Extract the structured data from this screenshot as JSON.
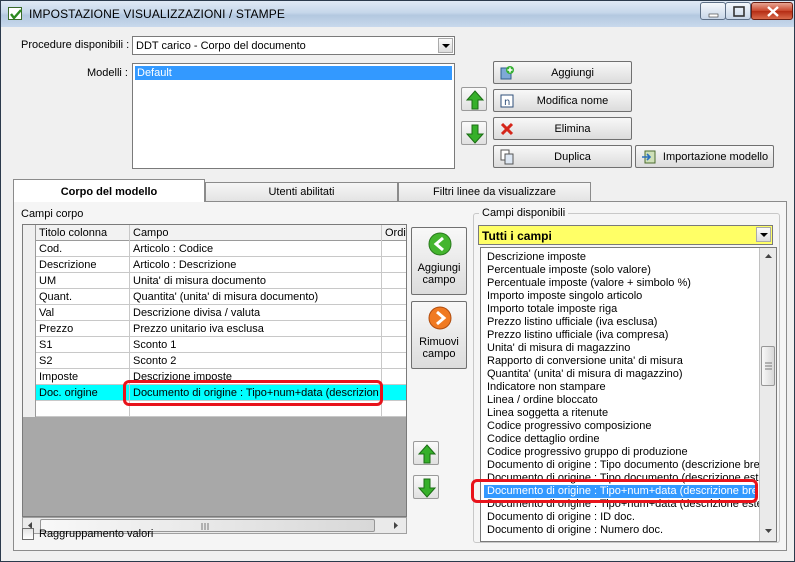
{
  "window": {
    "title": "IMPOSTAZIONE VISUALIZZAZIONI / STAMPE"
  },
  "procedure": {
    "label": "Procedure disponibili :",
    "selected": "DDT carico - Corpo del documento"
  },
  "modelli": {
    "label": "Modelli :",
    "items": [
      "Default"
    ]
  },
  "buttons": {
    "aggiungi": "Aggiungi",
    "modifica_nome": "Modifica nome",
    "elimina": "Elimina",
    "duplica": "Duplica",
    "importazione_modello": "Importazione modello",
    "aggiungi_campo_line1": "Aggiungi",
    "aggiungi_campo_line2": "campo",
    "rimuovi_campo_line1": "Rimuovi",
    "rimuovi_campo_line2": "campo"
  },
  "tabs": [
    {
      "label": "Corpo del modello",
      "active": true
    },
    {
      "label": "Utenti abilitati",
      "active": false
    },
    {
      "label": "Filtri linee da visualizzare",
      "active": false
    }
  ],
  "campi_corpo": {
    "group_label": "Campi corpo",
    "columns": [
      "Titolo colonna",
      "Campo",
      "Ordi"
    ],
    "rows": [
      {
        "titolo": "Cod.",
        "campo": "Articolo : Codice"
      },
      {
        "titolo": "Descrizione",
        "campo": "Articolo : Descrizione"
      },
      {
        "titolo": "UM",
        "campo": "Unita' di misura documento"
      },
      {
        "titolo": "Quant.",
        "campo": "Quantita' (unita' di misura documento)"
      },
      {
        "titolo": "Val",
        "campo": "Descrizione divisa / valuta"
      },
      {
        "titolo": "Prezzo",
        "campo": "Prezzo unitario iva esclusa"
      },
      {
        "titolo": "S1",
        "campo": "Sconto 1"
      },
      {
        "titolo": "S2",
        "campo": "Sconto 2"
      },
      {
        "titolo": "Imposte",
        "campo": "Descrizione imposte"
      },
      {
        "titolo": "Doc. origine",
        "campo": "Documento di origine : Tipo+num+data (descrizion..."
      }
    ],
    "selected_row": 9
  },
  "raggruppamento": {
    "label": "Raggruppamento valori",
    "checked": false
  },
  "campi_disponibili": {
    "group_label": "Campi disponibili",
    "filter_selected": "Tutti i campi",
    "filter_color": "#ffff66",
    "items": [
      "Descrizione imposte",
      "Percentuale imposte (solo valore)",
      "Percentuale imposte (valore + simbolo %)",
      "Importo imposte singolo articolo",
      "Importo totale imposte riga",
      "Prezzo listino ufficiale (iva esclusa)",
      "Prezzo listino ufficiale (iva compresa)",
      "Unita' di misura di magazzino",
      "Rapporto di conversione unita' di misura",
      "Quantita' (unita' di misura di magazzino)",
      "Indicatore non stampare",
      "Linea / ordine bloccato",
      "Linea soggetta a ritenute",
      "Codice progressivo composizione",
      "Codice dettaglio ordine",
      "Codice progressivo gruppo di produzione",
      "Documento di origine : Tipo documento (descrizione breve)",
      "Documento di origine : Tipo documento (descrizione estesa)",
      "Documento di origine : Tipo+num+data (descrizione breve)",
      "Documento di origine : Tipo+num+data (descrizione estesa)",
      "Documento di origine : ID doc.",
      "Documento di origine : Numero doc."
    ],
    "selected_index": 18
  },
  "highlight_color": "#e8131b"
}
